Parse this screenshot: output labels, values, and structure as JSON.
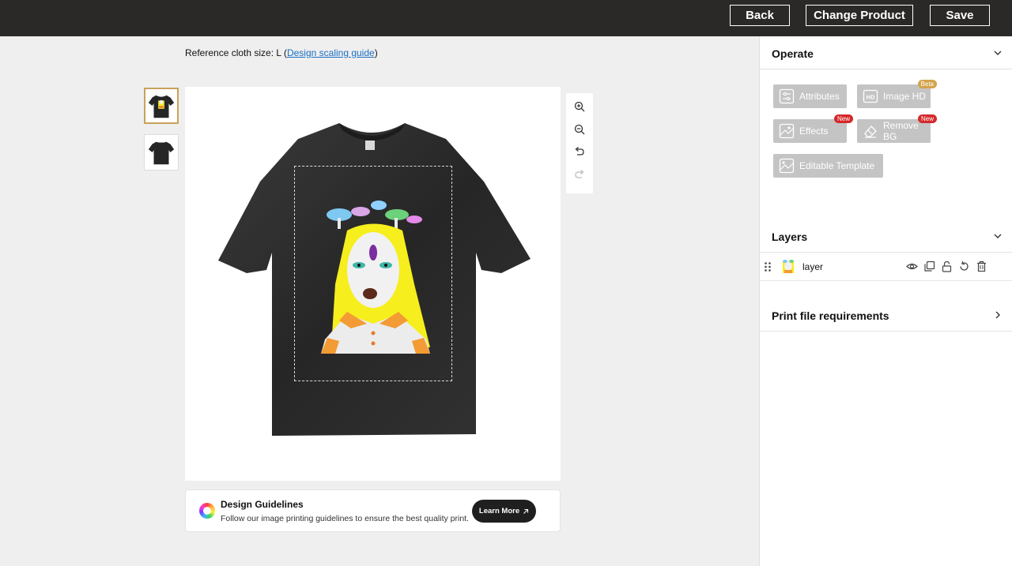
{
  "topbar": {
    "back_label": "Back",
    "change_product_label": "Change Product",
    "save_label": "Save"
  },
  "reference": {
    "prefix": "Reference cloth size: L (",
    "link_text": "Design scaling guide",
    "suffix": ")"
  },
  "thumbnails": [
    "front",
    "back"
  ],
  "guidelines": {
    "title": "Design Guidelines",
    "text": "Follow our image printing guidelines to ensure the best quality print.",
    "button_label": "Learn More"
  },
  "panel": {
    "operate": {
      "title": "Operate",
      "buttons": [
        {
          "label": "Attributes",
          "icon": "sliders-icon",
          "badge": ""
        },
        {
          "label": "Image HD",
          "icon": "hd-icon",
          "badge": "Beta"
        },
        {
          "label": "Effects",
          "icon": "effects-icon",
          "badge": "New"
        },
        {
          "label": "Remove BG",
          "icon": "eraser-icon",
          "badge": "New"
        },
        {
          "label": "Editable Template",
          "icon": "template-icon",
          "badge": ""
        }
      ]
    },
    "layers": {
      "title": "Layers",
      "items": [
        {
          "label": "layer"
        }
      ]
    },
    "print_requirements": {
      "title": "Print file requirements"
    }
  },
  "colors": {
    "topbar": "#2b2828",
    "disabled_button": "#c4c4c4",
    "badge_new": "#d6282b",
    "badge_beta": "#d4a44b",
    "link": "#1a6fc4",
    "active_thumb_border": "#c9a25a"
  }
}
